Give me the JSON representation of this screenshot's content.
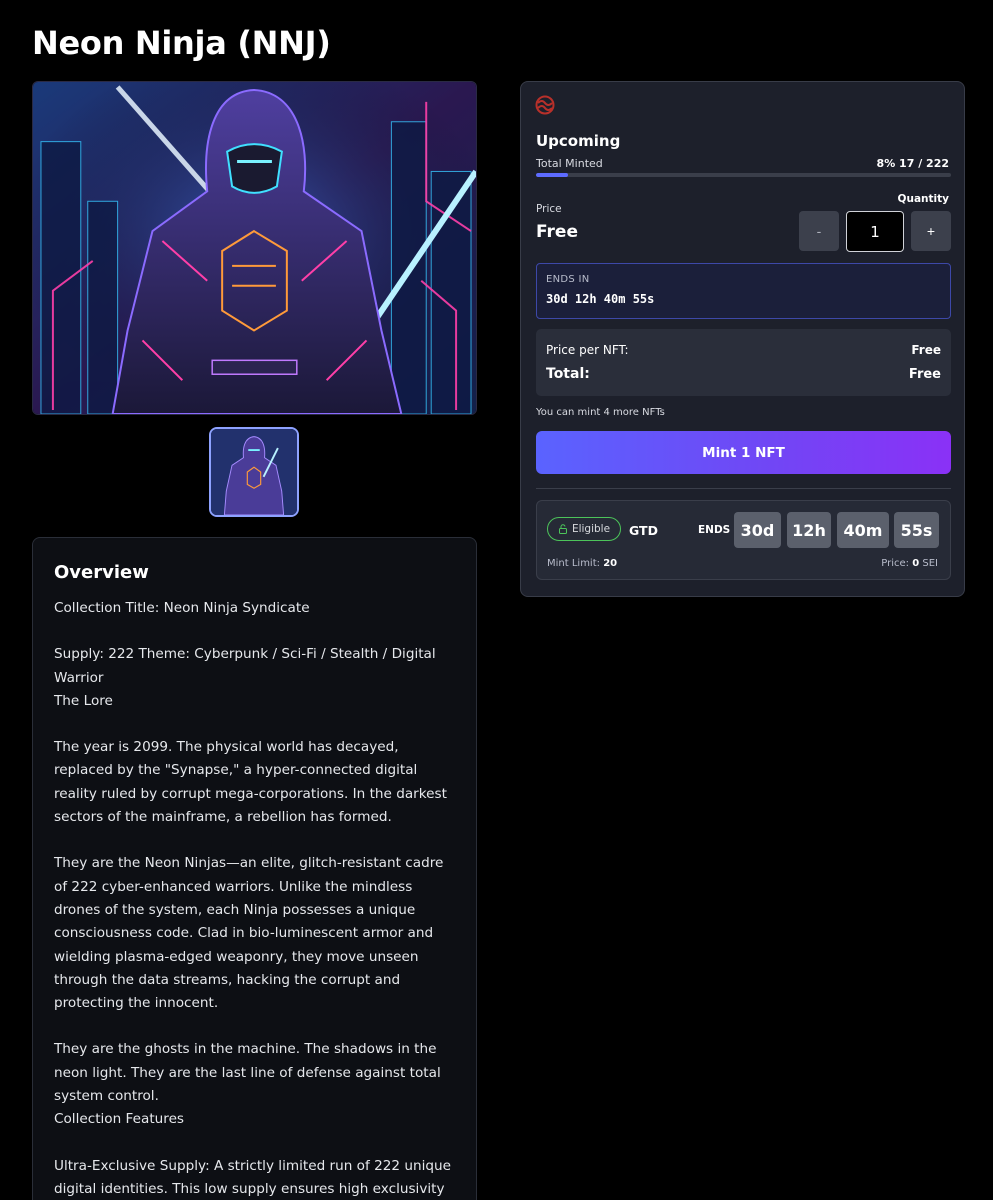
{
  "page": {
    "title": "Neon Ninja (NNJ)"
  },
  "media": {
    "hero_alt": "Neon Ninja artwork",
    "thumbnail_alt": "Neon Ninja thumbnail"
  },
  "overview": {
    "heading": "Overview",
    "paragraphs": [
      "Collection Title: Neon Ninja Syndicate",
      "Supply: 222 Theme: Cyberpunk / Sci-Fi / Stealth / Digital Warrior\nThe Lore",
      "The year is 2099. The physical world has decayed, replaced by the \"Synapse,\" a hyper-connected digital reality ruled by corrupt mega-corporations. In the darkest sectors of the mainframe, a rebellion has formed.",
      "They are the Neon Ninjas—an elite, glitch-resistant cadre of 222 cyber-enhanced warriors. Unlike the mindless drones of the system, each Ninja possesses a unique consciousness code. Clad in bio-luminescent armor and wielding plasma-edged weaponry, they move unseen through the data streams, hacking the corrupt and protecting the innocent.",
      "They are the ghosts in the machine. The shadows in the neon light. They are the last line of defense against total system control.\nCollection Features",
      "Ultra-Exclusive Supply: A strictly limited run of 222 unique digital identities. This low supply ensures high exclusivity and a focused, elite community of holders."
    ]
  },
  "mint": {
    "chain_icon": "sei-icon",
    "status": "Upcoming",
    "total_minted_label": "Total Minted",
    "total_minted_value": "8% 17 / 222",
    "minted_fraction": 0.077,
    "price_label": "Price",
    "price_value": "Free",
    "quantity_label": "Quantity",
    "quantity_value": "1",
    "minus_label": "-",
    "plus_label": "+",
    "ends_in_label": "ENDS IN",
    "ends_in_value": "30d 12h 40m 55s",
    "price_per_nft_label": "Price per NFT:",
    "price_per_nft_value": "Free",
    "total_label": "Total:",
    "total_value": "Free",
    "can_mint_text": "You can mint 4 more NFTs",
    "mint_button_label": "Mint 1 NFT",
    "accent_color": "#5d6bff"
  },
  "phase": {
    "eligible_label": "Eligible",
    "eligible_icon": "lock-open-icon",
    "name": "GTD",
    "ends_label": "ENDS",
    "countdown": [
      "30d",
      "12h",
      "40m",
      "55s"
    ],
    "mint_limit_label": "Mint Limit:",
    "mint_limit_value": "20",
    "price_label": "Price:",
    "price_value": "0",
    "price_unit": "SEI",
    "eligible_color": "#4cc45a"
  }
}
